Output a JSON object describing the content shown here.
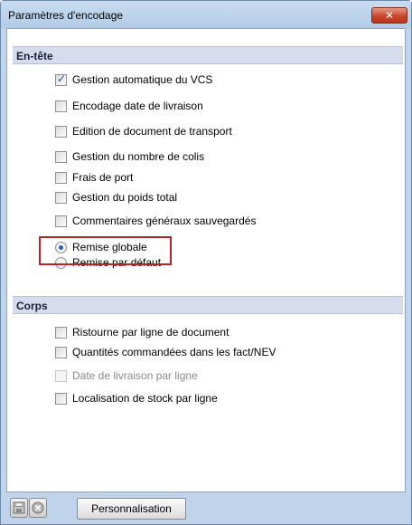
{
  "window": {
    "title": "Paramètres d'encodage",
    "close_glyph": "✕"
  },
  "sections": {
    "header": {
      "label": "En-tête",
      "items": [
        {
          "label": "Gestion automatique du VCS",
          "checked": true
        },
        {
          "label": "Encodage date de livraison",
          "checked": false
        },
        {
          "label": "Edition de document de transport",
          "checked": false
        },
        {
          "label": "Gestion du nombre de colis",
          "checked": false
        },
        {
          "label": "Frais de port",
          "checked": false
        },
        {
          "label": "Gestion du poids total",
          "checked": false
        },
        {
          "label": "Commentaires généraux sauvegardés",
          "checked": false
        }
      ],
      "radios": [
        {
          "label": "Remise globale",
          "selected": true
        },
        {
          "label": "Remise par défaut",
          "selected": false
        }
      ]
    },
    "body": {
      "label": "Corps",
      "items": [
        {
          "label": "Ristourne par ligne de document",
          "checked": false,
          "enabled": true
        },
        {
          "label": "Quantités commandées dans les fact/NEV",
          "checked": false,
          "enabled": true
        },
        {
          "label": "Date de livraison par ligne",
          "checked": false,
          "enabled": false
        },
        {
          "label": "Localisation de stock par ligne",
          "checked": false,
          "enabled": true
        }
      ]
    }
  },
  "footer": {
    "customize_label": "Personnalisation",
    "icons": [
      "save-icon",
      "cancel-icon"
    ]
  },
  "colors": {
    "highlight_border": "#b2252a",
    "section_header_bg": "#d6dcec",
    "close_button": "#c9472c"
  }
}
